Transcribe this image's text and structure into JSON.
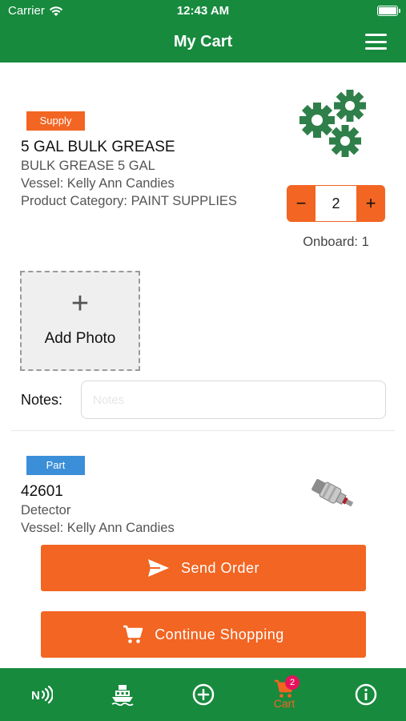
{
  "status_bar": {
    "carrier": "Carrier",
    "time": "12:43 AM"
  },
  "nav": {
    "title": "My Cart"
  },
  "items": [
    {
      "tag": "Supply",
      "tag_color": "#f26522",
      "title": "5 GAL BULK GREASE",
      "description": "BULK GREASE 5 GAL",
      "vessel": "Vessel: Kelly Ann Candies",
      "category": "Product Category: PAINT  SUPPLIES",
      "image_icon": "gears-icon",
      "quantity": "2",
      "minus_label": "−",
      "plus_label": "+",
      "onboard": "Onboard: 1"
    },
    {
      "tag": "Part",
      "tag_color": "#3b8fd9",
      "title": "42601",
      "description": "Detector",
      "vessel": "Vessel: Kelly Ann Candies",
      "image_icon": "detector-sensor-icon"
    }
  ],
  "photo": {
    "plus": "+",
    "label": "Add Photo"
  },
  "notes": {
    "label": "Notes:",
    "placeholder": "Notes",
    "value": ""
  },
  "buttons": {
    "send_order": "Send Order",
    "continue_shopping": "Continue Shopping"
  },
  "tab_bar": {
    "tabs": [
      {
        "icon": "nfc-icon"
      },
      {
        "icon": "vessel-icon"
      },
      {
        "icon": "add-circle-icon"
      },
      {
        "icon": "cart-icon",
        "label": "Cart",
        "badge": "2"
      },
      {
        "icon": "info-icon"
      }
    ]
  },
  "colors": {
    "brand_green": "#178a3e",
    "accent_orange": "#f26522",
    "gear_green": "#2f7f4a",
    "badge_pink": "#e5135d"
  }
}
